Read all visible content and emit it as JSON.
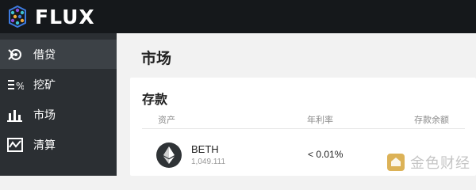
{
  "app": {
    "name": "FLUX"
  },
  "sidebar": {
    "items": [
      {
        "label": "借贷",
        "icon": "lend-icon",
        "active": true
      },
      {
        "label": "挖矿",
        "icon": "mining-percent-icon",
        "active": false
      },
      {
        "label": "市场",
        "icon": "bar-chart-icon",
        "active": false
      },
      {
        "label": "清算",
        "icon": "liquidation-chart-icon",
        "active": false
      }
    ]
  },
  "main": {
    "title": "市场",
    "deposit": {
      "title": "存款",
      "columns": {
        "asset": "资产",
        "apy": "年利率",
        "balance": "存款余额"
      },
      "rows": [
        {
          "asset": "BETH",
          "amount": "1,049.111",
          "apy": "< 0.01%",
          "icon": "ethereum-icon"
        }
      ]
    }
  },
  "watermark": {
    "text": "金色财经"
  },
  "colors": {
    "topbar": "#15181b",
    "sidebar": "#2b2f33",
    "sidebar_active": "#3c4146",
    "page_bg": "#f2f2f2"
  }
}
